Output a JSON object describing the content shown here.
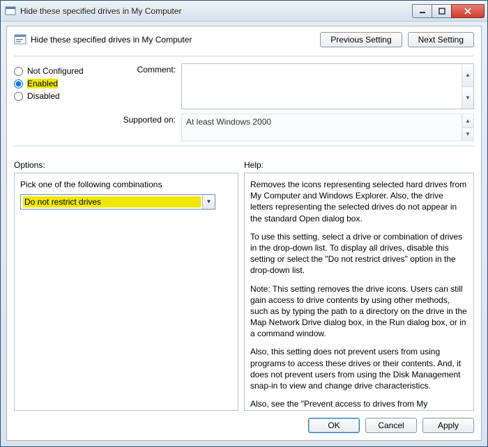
{
  "window": {
    "title": "Hide these specified drives in My Computer"
  },
  "header": {
    "title": "Hide these specified drives in My Computer",
    "previous_setting": "Previous Setting",
    "next_setting": "Next Setting"
  },
  "config": {
    "not_configured_label": "Not Configured",
    "enabled_label": "Enabled",
    "disabled_label": "Disabled",
    "selected": "Enabled",
    "comment_label": "Comment:",
    "comment_value": "",
    "supported_label": "Supported on:",
    "supported_value": "At least Windows 2000"
  },
  "lower": {
    "options_label": "Options:",
    "help_label": "Help:",
    "options": {
      "instruction": "Pick one of the following combinations",
      "selected": "Do not restrict drives"
    },
    "help": {
      "p1": "Removes the icons representing selected hard drives from My Computer and Windows Explorer. Also, the drive letters representing the selected drives do not appear in the standard Open dialog box.",
      "p2": "To use this setting, select a drive or combination of drives in the drop-down list. To display all drives, disable this setting or select the \"Do not restrict drives\" option in the drop-down list.",
      "p3": "Note: This setting removes the drive icons. Users can still gain access to drive contents by using other methods, such as by typing the path to a directory on the drive in the Map Network Drive dialog box, in the Run dialog box, or in a command window.",
      "p4": "Also, this setting does not prevent users from using programs to access these drives or their contents. And, it does not prevent users from using the Disk Management snap-in to view and change drive characteristics.",
      "p5": "Also, see the \"Prevent access to drives from My Computer\""
    }
  },
  "footer": {
    "ok": "OK",
    "cancel": "Cancel",
    "apply": "Apply"
  }
}
